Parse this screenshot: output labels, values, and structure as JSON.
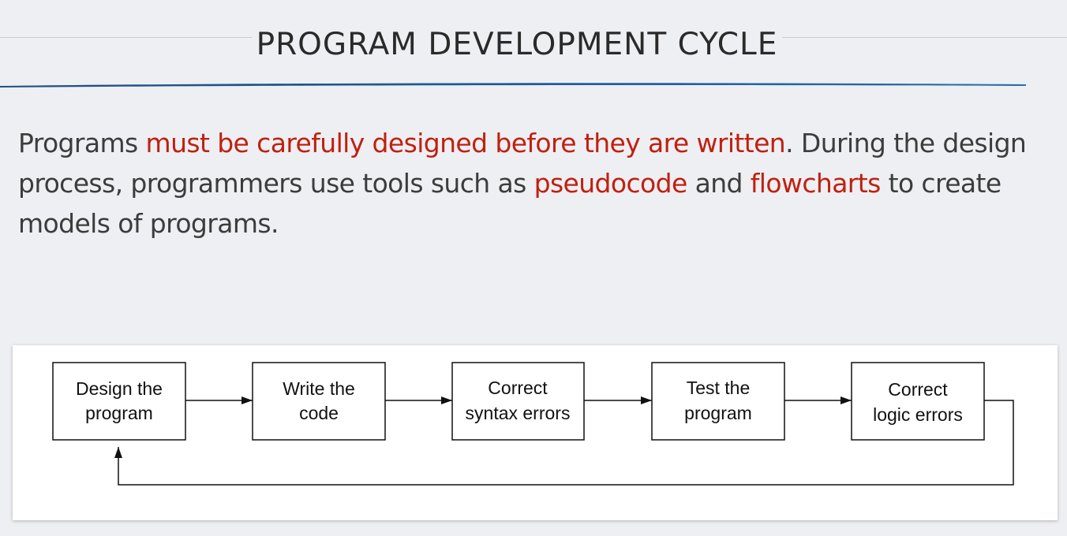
{
  "slide": {
    "title": "PROGRAM DEVELOPMENT CYCLE",
    "body": {
      "t1": "Programs ",
      "h1": "must be carefully designed before they are written",
      "t2": ". During the design process, programmers use tools such as ",
      "h2": "pseudocode",
      "t3": " and ",
      "h3": "flowcharts",
      "t4": " to create models of programs."
    },
    "colors": {
      "highlight": "#c0200f",
      "text": "#3c3c3c",
      "accent_line": "#1f5b95"
    }
  },
  "diagram": {
    "nodes": [
      {
        "line1": "Design the",
        "line2": "program"
      },
      {
        "line1": "Write the",
        "line2": "code"
      },
      {
        "line1": "Correct",
        "line2": "syntax errors"
      },
      {
        "line1": "Test the",
        "line2": "program"
      },
      {
        "line1": "Correct",
        "line2": "logic errors"
      }
    ]
  }
}
